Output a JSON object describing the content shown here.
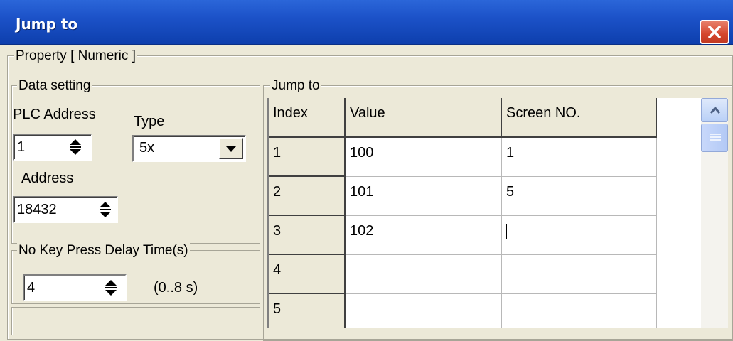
{
  "window": {
    "title": "Jump to",
    "close_icon": "close-icon",
    "accent": "#1c52c8",
    "close_color": "#d5472d"
  },
  "property": {
    "legend": "Property [ Numeric ]"
  },
  "data_setting": {
    "legend": "Data setting",
    "plc_address_label": "PLC Address",
    "type_label": "Type",
    "plc_address_value": "1",
    "type_value": "5x",
    "address_label": "Address",
    "address_value": "18432"
  },
  "delay": {
    "legend": "No Key Press Delay Time(s)",
    "value": "4",
    "range": "(0..8 s)"
  },
  "jump_table": {
    "legend": "Jump to",
    "headers": [
      "Index",
      "Value",
      "Screen NO."
    ],
    "rows": [
      {
        "index": "1",
        "value": "100",
        "screen": "1"
      },
      {
        "index": "2",
        "value": "101",
        "screen": "5"
      },
      {
        "index": "3",
        "value": "102",
        "screen": ""
      },
      {
        "index": "4",
        "value": "",
        "screen": ""
      },
      {
        "index": "5",
        "value": "",
        "screen": ""
      }
    ]
  }
}
